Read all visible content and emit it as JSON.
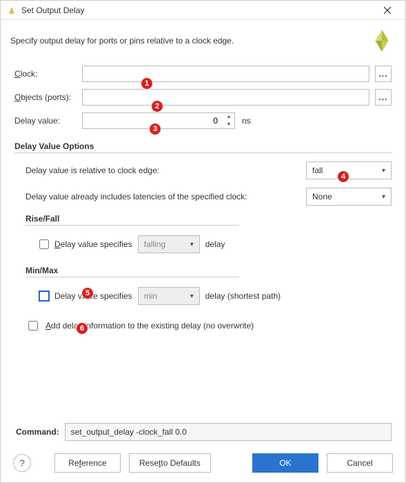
{
  "window": {
    "title": "Set Output Delay",
    "description": "Specify output delay for ports or pins relative to a clock edge."
  },
  "form": {
    "clock_label_prefix": "C",
    "clock_label_rest": "lock:",
    "clock_value": "",
    "objects_label_prefix": "O",
    "objects_label_rest": "bjects (ports):",
    "objects_value": "",
    "delay_label": "Delay value:",
    "delay_value": "0",
    "delay_unit": "ns"
  },
  "options": {
    "section_title": "Delay Value Options",
    "rel_edge_label": "Delay value is relative to clock edge:",
    "rel_edge_selected": "fall",
    "latencies_label_pre": "De",
    "latencies_label_ul": "l",
    "latencies_label_post": "ay value already includes latencies of the specified clock:",
    "latencies_selected": "None",
    "rise_fall_title": "Rise/Fall",
    "rise_fall_cb_ul": "D",
    "rise_fall_cb_rest": "elay value specifies",
    "rise_fall_select": "falling",
    "rise_fall_suffix": "delay",
    "min_max_title": "Min/Max",
    "min_max_cb_label": "Delay value specifies",
    "min_max_select": "min",
    "min_max_suffix": "delay (shortest path)",
    "add_cb_ul": "A",
    "add_cb_rest": "dd delay information to the existing delay (no overwrite)"
  },
  "command": {
    "label": "Command:",
    "text": "set_output_delay -clock_fall 0.0"
  },
  "footer": {
    "help": "?",
    "reference_pre": "Re",
    "reference_ul": "f",
    "reference_post": "erence",
    "reset_pre": "Rese",
    "reset_ul": "t",
    "reset_post": " to Defaults",
    "ok": "OK",
    "cancel": "Cancel"
  },
  "badges": [
    "1",
    "2",
    "3",
    "4",
    "5",
    "6"
  ],
  "more_btn": "..."
}
